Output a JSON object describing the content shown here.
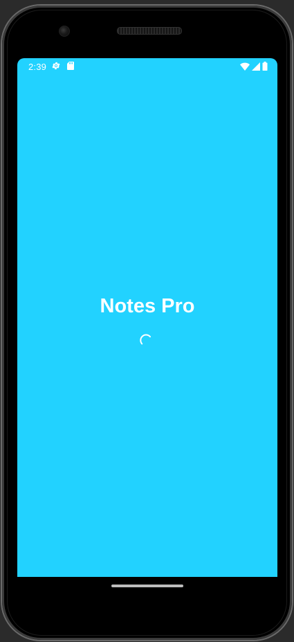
{
  "status_bar": {
    "time": "2:39",
    "icons": [
      "settings-icon",
      "sd-card-icon",
      "wifi-icon",
      "cell-signal-icon",
      "battery-icon"
    ]
  },
  "splash": {
    "title": "Notes Pro",
    "loading_indicator": "progress-spinner-icon"
  },
  "colors": {
    "splash_background": "#22d2ff",
    "foreground": "#ffffff",
    "device_frame": "#000000"
  }
}
